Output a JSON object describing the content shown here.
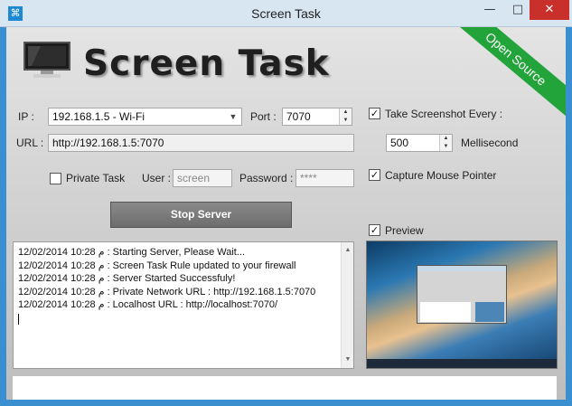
{
  "window": {
    "title": "Screen Task",
    "controls": {
      "minimize": "—",
      "maximize": "□",
      "close": "✕"
    }
  },
  "logo": {
    "text": "Screen Task",
    "ribbon": "Open Source"
  },
  "form": {
    "ip_label": "IP :",
    "ip_value": "192.168.1.5 - Wi-Fi",
    "port_label": "Port :",
    "port_value": "7070",
    "url_label": "URL :",
    "url_value": "http://192.168.1.5:7070",
    "private_task_label": "Private Task",
    "private_task_checked": false,
    "user_label": "User :",
    "user_value": "screen",
    "password_label": "Password :",
    "password_value": "****"
  },
  "options": {
    "take_screenshot_label": "Take Screenshot Every :",
    "take_screenshot_checked": true,
    "interval_value": "500",
    "interval_unit": "Mellisecond",
    "capture_pointer_label": "Capture Mouse Pointer",
    "capture_pointer_checked": true,
    "preview_label": "Preview",
    "preview_checked": true
  },
  "buttons": {
    "stop_server": "Stop Server"
  },
  "log": {
    "lines": [
      "12/02/2014 10:28 م : Starting Server, Please Wait...",
      "12/02/2014 10:28 م : Screen Task Rule updated to your firewall",
      "12/02/2014 10:28 م : Server Started Successfuly!",
      "12/02/2014 10:28 م : Private Network URL : http://192.168.1.5:7070",
      "12/02/2014 10:28 م : Localhost URL : http://localhost:7070/"
    ]
  },
  "colors": {
    "ribbon": "#22a43a",
    "button": "#7a7a7a",
    "window_border": "#3a8fd1"
  }
}
